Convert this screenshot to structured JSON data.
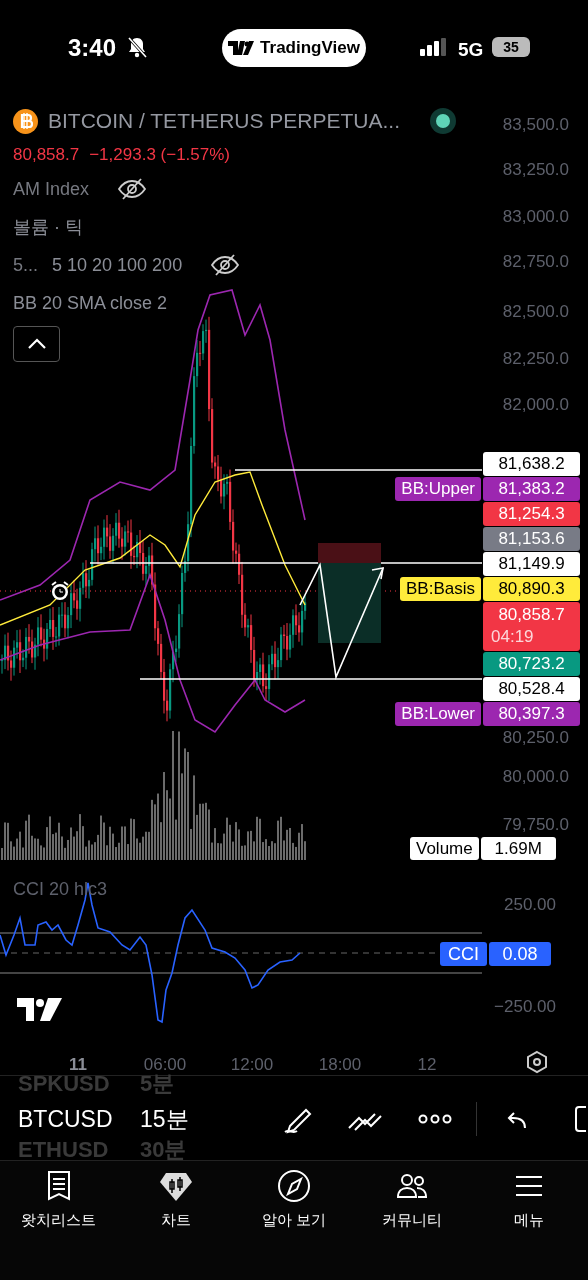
{
  "status_bar": {
    "time": "3:40",
    "app": "TradingView",
    "network": "5G",
    "battery": "35"
  },
  "legend": {
    "symbol": "BITCOIN / TETHERUS PERPETUA...",
    "price": "80,858.7",
    "change": "−1,293.3 (−1.57%)",
    "indicators": [
      {
        "name": "AM Index",
        "hidden": true
      },
      {
        "name": "볼륨 · 틱",
        "hidden": false
      },
      {
        "name": "5...",
        "params": "5 10 20 100 200",
        "hidden": true
      },
      {
        "name": "BB 20 SMA close 2",
        "hidden": false
      }
    ]
  },
  "price_axis": [
    "83,500.0",
    "83,250.0",
    "83,000.0",
    "82,750.0",
    "82,500.0",
    "82,250.0",
    "82,000.0",
    "80,250.0",
    "80,000.0",
    "79,750.0"
  ],
  "price_tags": [
    {
      "value": "81,638.2",
      "color": "#ffffff"
    },
    {
      "label": "BB:Upper",
      "value": "81,383.2",
      "color": "#9c27b0"
    },
    {
      "value": "81,254.3",
      "color": "#f23645"
    },
    {
      "value": "81,153.6",
      "color": "#787b86"
    },
    {
      "value": "81,149.9",
      "color": "#ffffff"
    },
    {
      "label": "BB:Basis",
      "value": "80,890.3",
      "color": "#ffeb3b"
    },
    {
      "value": "80,858.7",
      "countdown": "04:19",
      "color": "#f23645"
    },
    {
      "value": "80,723.2",
      "color": "#089981"
    },
    {
      "value": "80,528.4",
      "color": "#ffffff"
    },
    {
      "label": "BB:Lower",
      "value": "80,397.3",
      "color": "#9c27b0"
    }
  ],
  "volume_tag": {
    "label": "Volume",
    "value": "1.69M"
  },
  "cci": {
    "title": "CCI 20 hlc3",
    "ticks": [
      "250.00",
      "−250.00"
    ],
    "tag_label": "CCI",
    "tag_value": "0.08"
  },
  "time_axis": [
    {
      "label": "11",
      "major": true
    },
    {
      "label": "06:00",
      "major": false
    },
    {
      "label": "12:00",
      "major": false
    },
    {
      "label": "18:00",
      "major": false
    },
    {
      "label": "12",
      "major": false
    }
  ],
  "symbol_picker": [
    {
      "symbol": "SPKUSD",
      "interval": "5분",
      "selected": false
    },
    {
      "symbol": "BTCUSD",
      "interval": "15분",
      "selected": true
    },
    {
      "symbol": "ETHUSD",
      "interval": "30분",
      "selected": false
    }
  ],
  "bottom_nav": [
    {
      "label": "왓치리스트",
      "kind": "watchlist"
    },
    {
      "label": "차트",
      "kind": "chart"
    },
    {
      "label": "알아 보기",
      "kind": "explore"
    },
    {
      "label": "커뮤니티",
      "kind": "community"
    },
    {
      "label": "메뉴",
      "kind": "menu"
    }
  ]
}
